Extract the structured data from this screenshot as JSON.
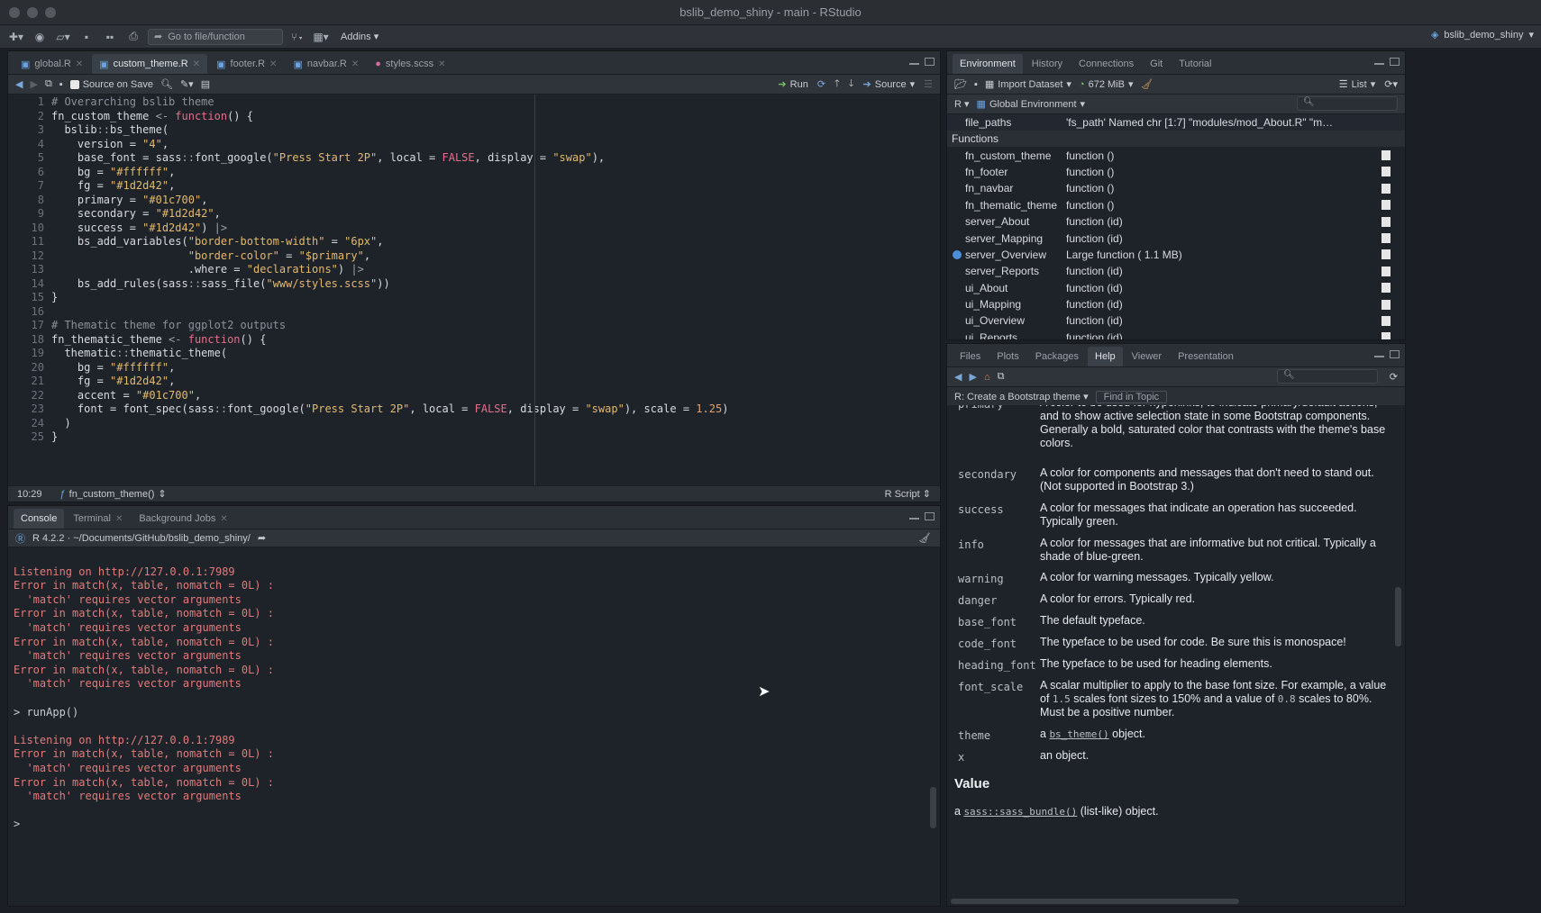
{
  "window": {
    "title": "bslib_demo_shiny - main - RStudio"
  },
  "toolbar": {
    "goto": "Go to file/function",
    "addins": "Addins",
    "project": "bslib_demo_shiny"
  },
  "editor": {
    "tabs": [
      "global.R",
      "custom_theme.R",
      "footer.R",
      "navbar.R",
      "styles.scss"
    ],
    "source_on_save": "Source on Save",
    "run": "Run",
    "source": "Source",
    "status": {
      "position": "10:29",
      "scope": "fn_custom_theme()",
      "type": "R Script"
    },
    "line_numbers": [
      "1",
      "2",
      "3",
      "4",
      "5",
      "6",
      "7",
      "8",
      "9",
      "10",
      "11",
      "12",
      "13",
      "14",
      "15",
      "16",
      "17",
      "18",
      "19",
      "20",
      "21",
      "22",
      "23",
      "24",
      "25"
    ],
    "lines": [
      "# Overarching bslib theme",
      "fn_custom_theme <- function() {",
      "  bslib::bs_theme(",
      "    version = \"4\",",
      "    base_font = sass::font_google(\"Press Start 2P\", local = FALSE, display = \"swap\"),",
      "    bg = \"#ffffff\",",
      "    fg = \"#1d2d42\",",
      "    primary = \"#01c700\",",
      "    secondary = \"#1d2d42\",",
      "    success = \"#1d2d42\") |>",
      "    bs_add_variables(\"border-bottom-width\" = \"6px\",",
      "                     \"border-color\" = \"$primary\",",
      "                     .where = \"declarations\") |>",
      "    bs_add_rules(sass::sass_file(\"www/styles.scss\"))",
      "}",
      "",
      "# Thematic theme for ggplot2 outputs",
      "fn_thematic_theme <- function() {",
      "  thematic::thematic_theme(",
      "    bg = \"#ffffff\",",
      "    fg = \"#1d2d42\",",
      "    accent = \"#01c700\",",
      "    font = font_spec(sass::font_google(\"Press Start 2P\", local = FALSE, display = \"swap\"), scale = 1.25)",
      "  )",
      "}"
    ]
  },
  "console": {
    "tabs": [
      "Console",
      "Terminal",
      "Background Jobs"
    ],
    "path": "R 4.2.2 · ~/Documents/GitHub/bslib_demo_shiny/",
    "lines": [
      {
        "t": "",
        "c": "prompt"
      },
      {
        "t": "Listening on http://127.0.0.1:7989",
        "c": "err"
      },
      {
        "t": "Error in match(x, table, nomatch = 0L) :",
        "c": "err"
      },
      {
        "t": "  'match' requires vector arguments",
        "c": "err"
      },
      {
        "t": "Error in match(x, table, nomatch = 0L) :",
        "c": "err"
      },
      {
        "t": "  'match' requires vector arguments",
        "c": "err"
      },
      {
        "t": "Error in match(x, table, nomatch = 0L) :",
        "c": "err"
      },
      {
        "t": "  'match' requires vector arguments",
        "c": "err"
      },
      {
        "t": "Error in match(x, table, nomatch = 0L) :",
        "c": "err"
      },
      {
        "t": "  'match' requires vector arguments",
        "c": "err"
      },
      {
        "t": "",
        "c": "prompt"
      },
      {
        "t": "> runApp()",
        "c": "prompt"
      },
      {
        "t": "",
        "c": "prompt"
      },
      {
        "t": "Listening on http://127.0.0.1:7989",
        "c": "err"
      },
      {
        "t": "Error in match(x, table, nomatch = 0L) :",
        "c": "err"
      },
      {
        "t": "  'match' requires vector arguments",
        "c": "err"
      },
      {
        "t": "Error in match(x, table, nomatch = 0L) :",
        "c": "err"
      },
      {
        "t": "  'match' requires vector arguments",
        "c": "err"
      },
      {
        "t": "",
        "c": "prompt"
      },
      {
        "t": ">",
        "c": "prompt"
      }
    ]
  },
  "environment": {
    "tabs": [
      "Environment",
      "History",
      "Connections",
      "Git",
      "Tutorial"
    ],
    "import_dataset": "Import Dataset",
    "memory": "672 MiB",
    "view": "List",
    "lang": "R",
    "scope": "Global Environment",
    "top_row": {
      "name": "file_paths",
      "value": "'fs_path' Named chr [1:7] \"modules/mod_About.R\" \"m…"
    },
    "section": "Functions",
    "functions": [
      {
        "name": "fn_custom_theme",
        "value": "function ()"
      },
      {
        "name": "fn_footer",
        "value": "function ()"
      },
      {
        "name": "fn_navbar",
        "value": "function ()"
      },
      {
        "name": "fn_thematic_theme",
        "value": "function ()"
      },
      {
        "name": "server_About",
        "value": "function (id)"
      },
      {
        "name": "server_Mapping",
        "value": "function (id)"
      },
      {
        "name": "server_Overview",
        "value": "Large function ( 1.1 MB)"
      },
      {
        "name": "server_Reports",
        "value": "function (id)"
      },
      {
        "name": "ui_About",
        "value": "function (id)"
      },
      {
        "name": "ui_Mapping",
        "value": "function (id)"
      },
      {
        "name": "ui_Overview",
        "value": "function (id)"
      },
      {
        "name": "ui_Reports",
        "value": "function (id)"
      }
    ]
  },
  "help": {
    "tabs": [
      "Files",
      "Plots",
      "Packages",
      "Help",
      "Viewer",
      "Presentation"
    ],
    "topic": "R: Create a Bootstrap theme",
    "find": "Find in Topic",
    "args": [
      {
        "name": "primary",
        "desc": "A color to be used for hyperlinks, to indicate primary/default actions, and to show active selection state in some Bootstrap components. Generally a bold, saturated color that contrasts with the theme's base colors."
      },
      {
        "name": "secondary",
        "desc": "A color for components and messages that don't need to stand out. (Not supported in Bootstrap 3.)"
      },
      {
        "name": "success",
        "desc": "A color for messages that indicate an operation has succeeded. Typically green."
      },
      {
        "name": "info",
        "desc": "A color for messages that are informative but not critical. Typically a shade of blue-green."
      },
      {
        "name": "warning",
        "desc": "A color for warning messages. Typically yellow."
      },
      {
        "name": "danger",
        "desc": "A color for errors. Typically red."
      },
      {
        "name": "base_font",
        "desc": "The default typeface."
      },
      {
        "name": "code_font",
        "desc": "The typeface to be used for code. Be sure this is monospace!"
      },
      {
        "name": "heading_font",
        "desc": "The typeface to be used for heading elements."
      },
      {
        "name": "font_scale",
        "desc_parts": [
          "A scalar multiplier to apply to the base font size. For example, a value of ",
          "1.5",
          " scales font sizes to 150% and a value of ",
          "0.8",
          " scales to 80%. Must be a positive number."
        ]
      },
      {
        "name": "theme",
        "desc_parts": [
          "a ",
          "bs_theme()",
          " object."
        ]
      },
      {
        "name": "x",
        "desc": "an object."
      }
    ],
    "value_heading": "Value",
    "value_parts": [
      "a ",
      "sass::sass_bundle()",
      " (list-like) object."
    ]
  }
}
